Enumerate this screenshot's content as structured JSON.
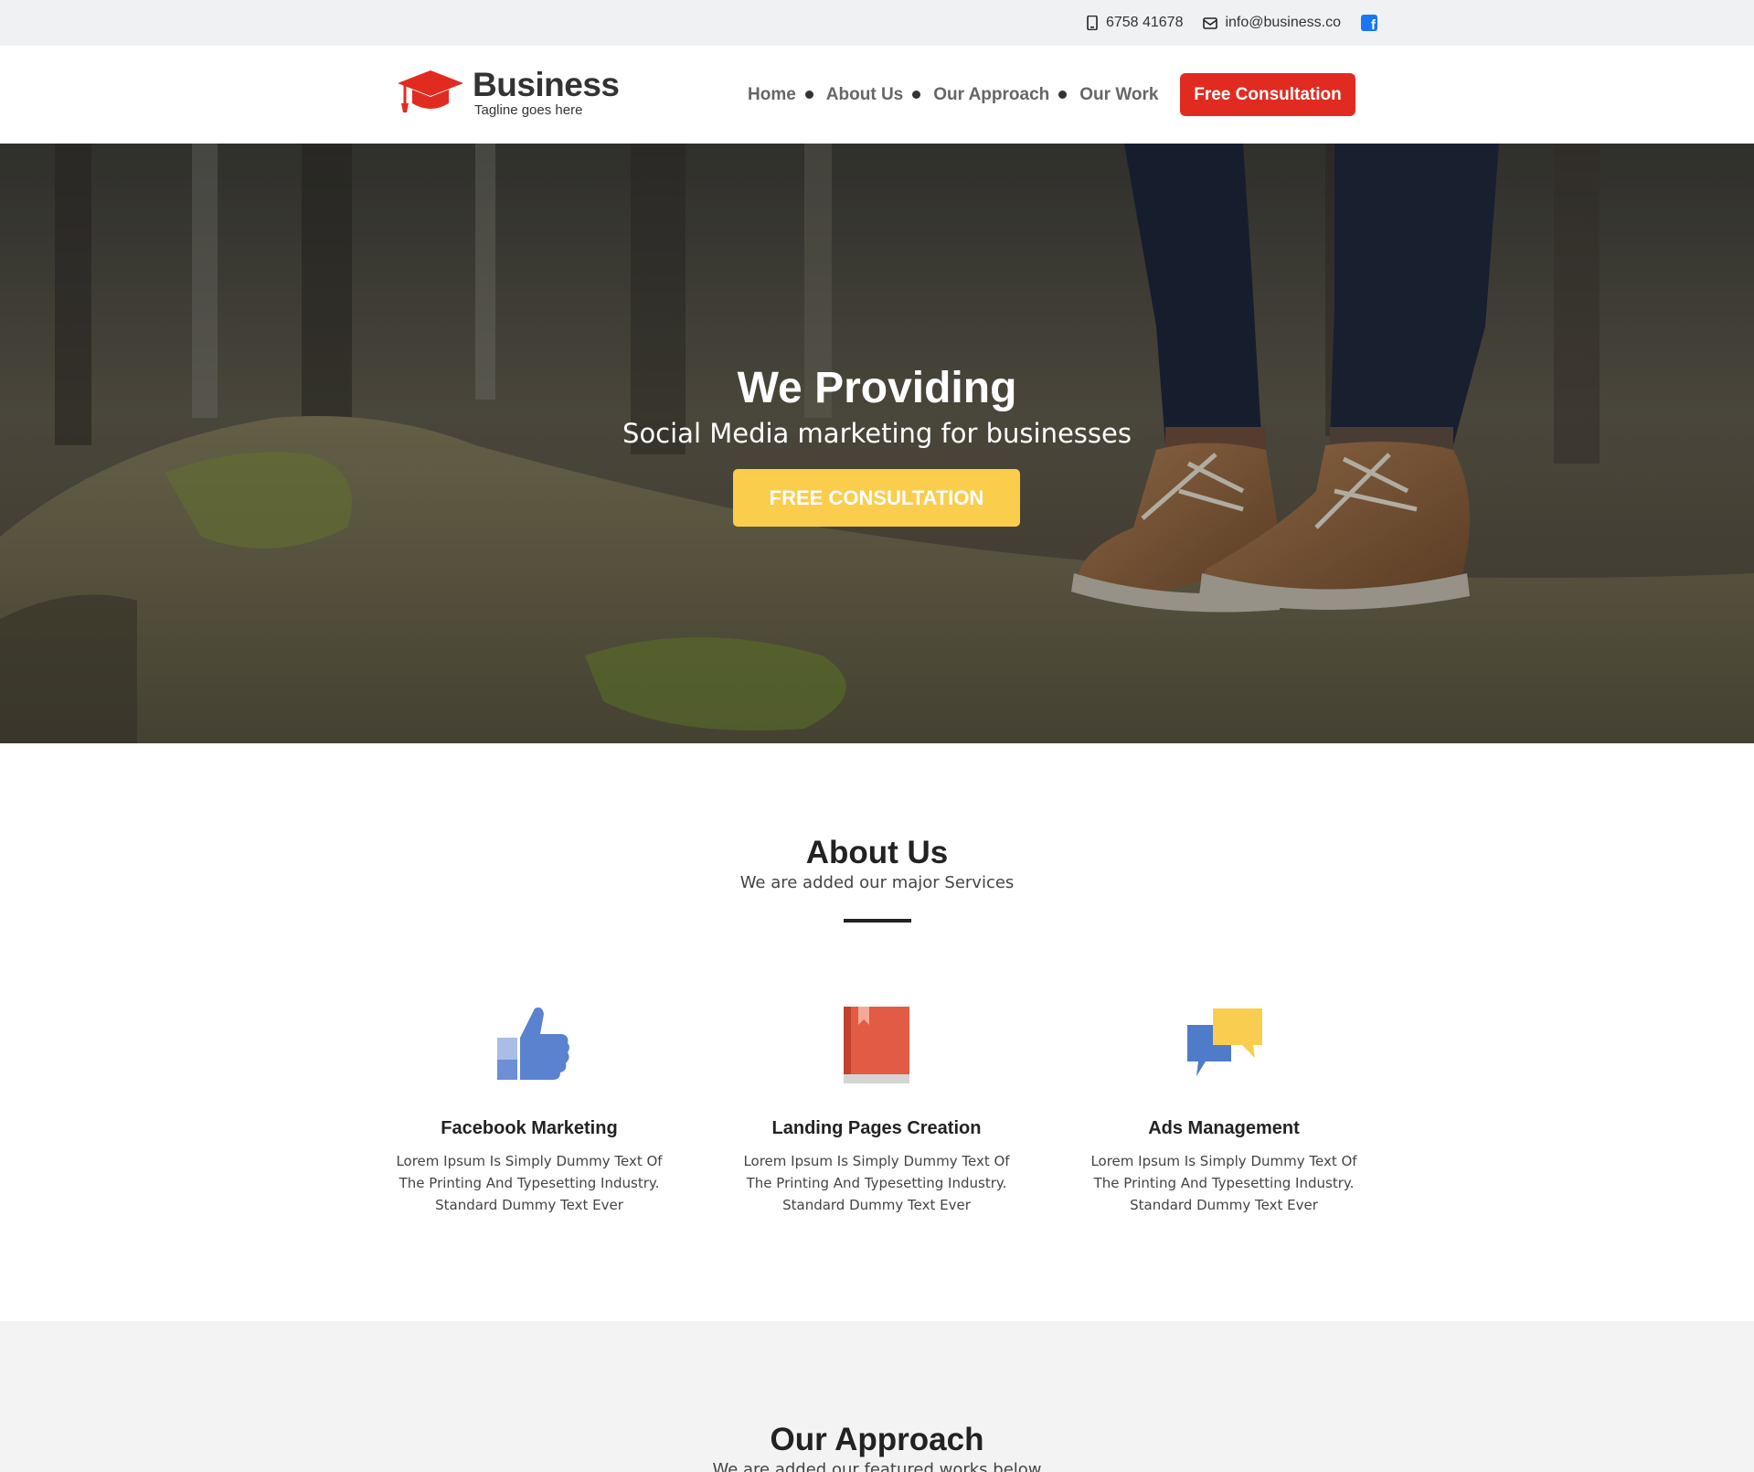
{
  "topbar": {
    "phone": "6758 41678",
    "email": "info@business.co",
    "phone_icon": "mobile-phone-icon",
    "email_icon": "envelope-icon",
    "social_icon": "facebook-icon"
  },
  "header": {
    "logo_name": "Business",
    "logo_tagline": "Tagline goes here",
    "logo_icon": "graduation-cap-icon",
    "nav": [
      {
        "label": "Home"
      },
      {
        "label": "About Us"
      },
      {
        "label": "Our Approach"
      },
      {
        "label": "Our Work"
      }
    ],
    "cta_label": "Free Consultation"
  },
  "hero": {
    "title": "We Providing",
    "subtitle": "Social Media marketing for businesses",
    "button_label": "FREE CONSULTATION"
  },
  "about": {
    "title": "About Us",
    "subtitle": "We are added our major Services",
    "services": [
      {
        "icon": "thumbs-up-icon",
        "title": "Facebook Marketing",
        "desc": "Lorem Ipsum Is Simply Dummy Text Of The Printing And Typesetting Industry. Standard Dummy Text Ever"
      },
      {
        "icon": "book-icon",
        "title": "Landing Pages Creation",
        "desc": "Lorem Ipsum Is Simply Dummy Text Of The Printing And Typesetting Industry. Standard Dummy Text Ever"
      },
      {
        "icon": "chat-bubbles-icon",
        "title": "Ads Management",
        "desc": "Lorem Ipsum Is Simply Dummy Text Of The Printing And Typesetting Industry. Standard Dummy Text Ever"
      }
    ]
  },
  "approach": {
    "title": "Our Approach",
    "subtitle": "We are added our featured works below"
  },
  "colors": {
    "brand_red": "#e12b21",
    "hero_button": "#fbcd4d",
    "topbar_bg": "#f0f1f3",
    "approach_bg": "#f3f3f3"
  }
}
